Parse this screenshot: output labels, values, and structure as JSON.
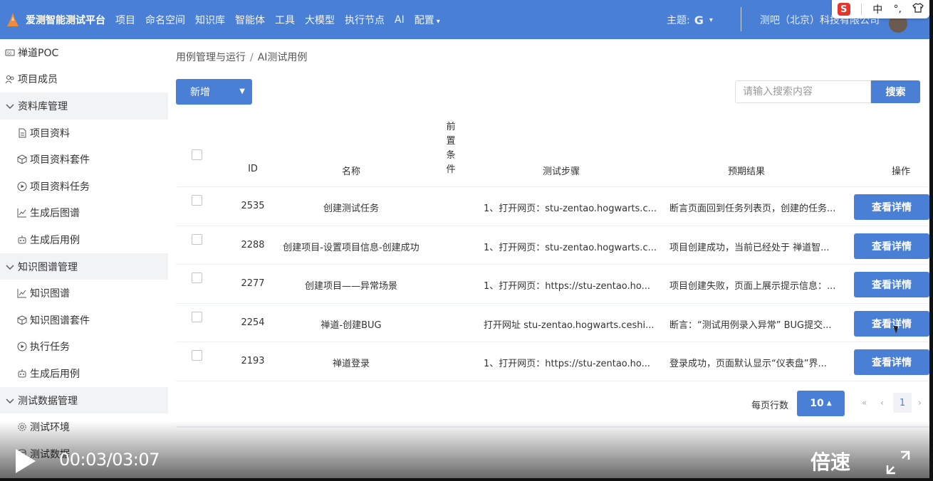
{
  "app": {
    "brand": "爱测智能测试平台",
    "nav": [
      "项目",
      "命名空间",
      "知识库",
      "智能体",
      "工具",
      "大模型",
      "执行节点",
      "AI",
      "配置"
    ],
    "theme_label": "主题:",
    "theme_value": "G",
    "company": "测吧（北京）科技有限公司"
  },
  "ime": {
    "logo": "S",
    "mode": "中",
    "punct": "°,",
    "skin": "👕"
  },
  "sidebar": [
    {
      "label": "禅道POC",
      "kind": "top",
      "icon": "poc-icon"
    },
    {
      "label": "项目成员",
      "kind": "top",
      "icon": "members-icon"
    },
    {
      "label": "资料库管理",
      "kind": "group",
      "icon": "chevron-down-icon"
    },
    {
      "label": "项目资料",
      "kind": "sub",
      "icon": "document-icon"
    },
    {
      "label": "项目资料套件",
      "kind": "sub",
      "icon": "cube-icon"
    },
    {
      "label": "项目资料任务",
      "kind": "sub",
      "icon": "play-circle-icon"
    },
    {
      "label": "生成后图谱",
      "kind": "sub",
      "icon": "line-chart-icon"
    },
    {
      "label": "生成后用例",
      "kind": "sub",
      "icon": "robot-icon"
    },
    {
      "label": "知识图谱管理",
      "kind": "group",
      "icon": "chevron-down-icon"
    },
    {
      "label": "知识图谱",
      "kind": "sub",
      "icon": "line-chart-icon"
    },
    {
      "label": "知识图谱套件",
      "kind": "sub",
      "icon": "cube-icon"
    },
    {
      "label": "执行任务",
      "kind": "sub",
      "icon": "play-circle-icon"
    },
    {
      "label": "生成后用例",
      "kind": "sub",
      "icon": "robot-icon"
    },
    {
      "label": "测试数据管理",
      "kind": "group",
      "icon": "chevron-down-icon"
    },
    {
      "label": "测试环境",
      "kind": "sub",
      "icon": "gear-icon"
    },
    {
      "label": "测试数据",
      "kind": "sub",
      "icon": "data-icon"
    }
  ],
  "breadcrumb": [
    "用例管理与运行",
    "AI测试用例"
  ],
  "toolbar": {
    "new_label": "新增",
    "search_placeholder": "请输入搜索内容",
    "search_label": "搜索"
  },
  "table": {
    "headers": {
      "id": "ID",
      "name": "名称",
      "precondition": "前置条件",
      "steps": "测试步骤",
      "expected": "预期结果",
      "action": "操作"
    },
    "rows": [
      {
        "id": "2535",
        "name": "创建测试任务",
        "steps": "1、打开网页：stu-zentao.hogwarts.c...",
        "expected": "断言页面回到任务列表页，创建的任务...",
        "action": "查看详情"
      },
      {
        "id": "2288",
        "name": "创建项目-设置项目信息-创建成功",
        "steps": "1、打开网页：stu-zentao.hogwarts.c...",
        "expected": "项目创建成功，当前已经处于 禅道智...",
        "action": "查看详情"
      },
      {
        "id": "2277",
        "name": "创建项目——异常场景",
        "steps": "1、打开网页：https://stu-zentao.ho...",
        "expected": "项目创建失败，页面上展示提示信息：...",
        "action": "查看详情"
      },
      {
        "id": "2254",
        "name": "禅道-创建BUG",
        "steps": "打开网址 stu-zentao.hogwarts.ceshi...",
        "expected": "断言：“测试用例录入异常” BUG提交...",
        "action": "查看详情"
      },
      {
        "id": "2193",
        "name": "禅道登录",
        "steps": "1、打开网页：https://stu-zentao.ho...",
        "expected": "登录成功，页面默认显示“仪表盘”界...",
        "action": "查看详情"
      }
    ]
  },
  "pagination": {
    "rows_label": "每页行数",
    "page_size": "10",
    "first": "«",
    "prev": "‹",
    "current": "1",
    "next": "›"
  },
  "video": {
    "time": "00:03/03:07",
    "speed_label": "倍速"
  }
}
